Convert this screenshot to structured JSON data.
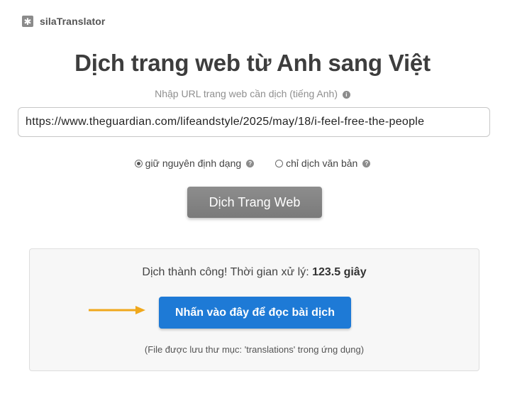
{
  "brand": {
    "name": "silaTranslator",
    "logo_glyph": "✱"
  },
  "page": {
    "title": "Dịch trang web từ Anh sang Việt",
    "url_hint": "Nhập URL trang web cần dịch (tiếng Anh)",
    "url_value": "https://www.theguardian.com/lifeandstyle/2025/may/18/i-feel-free-the-people"
  },
  "options": [
    {
      "label": "giữ nguyên định dạng",
      "checked": true
    },
    {
      "label": "chỉ dịch văn bản",
      "checked": false
    }
  ],
  "translate_button": {
    "label": "Dịch Trang Web"
  },
  "result": {
    "success_prefix": "Dịch thành công! Thời gian xử lý:",
    "duration": "123.5 giây",
    "read_button": "Nhấn vào đây để đọc bài dịch",
    "note": "(File được lưu thư mục: 'translations' trong ứng dụng)"
  },
  "colors": {
    "accent": "#1e7ad6",
    "arrow": "#f0a81c",
    "translate_button_bg": "#858585"
  },
  "icons": {
    "brand": "asterisk-logo-icon",
    "hint": "info-icon",
    "option_help": "question-icon",
    "pointer": "arrow-right-icon"
  }
}
